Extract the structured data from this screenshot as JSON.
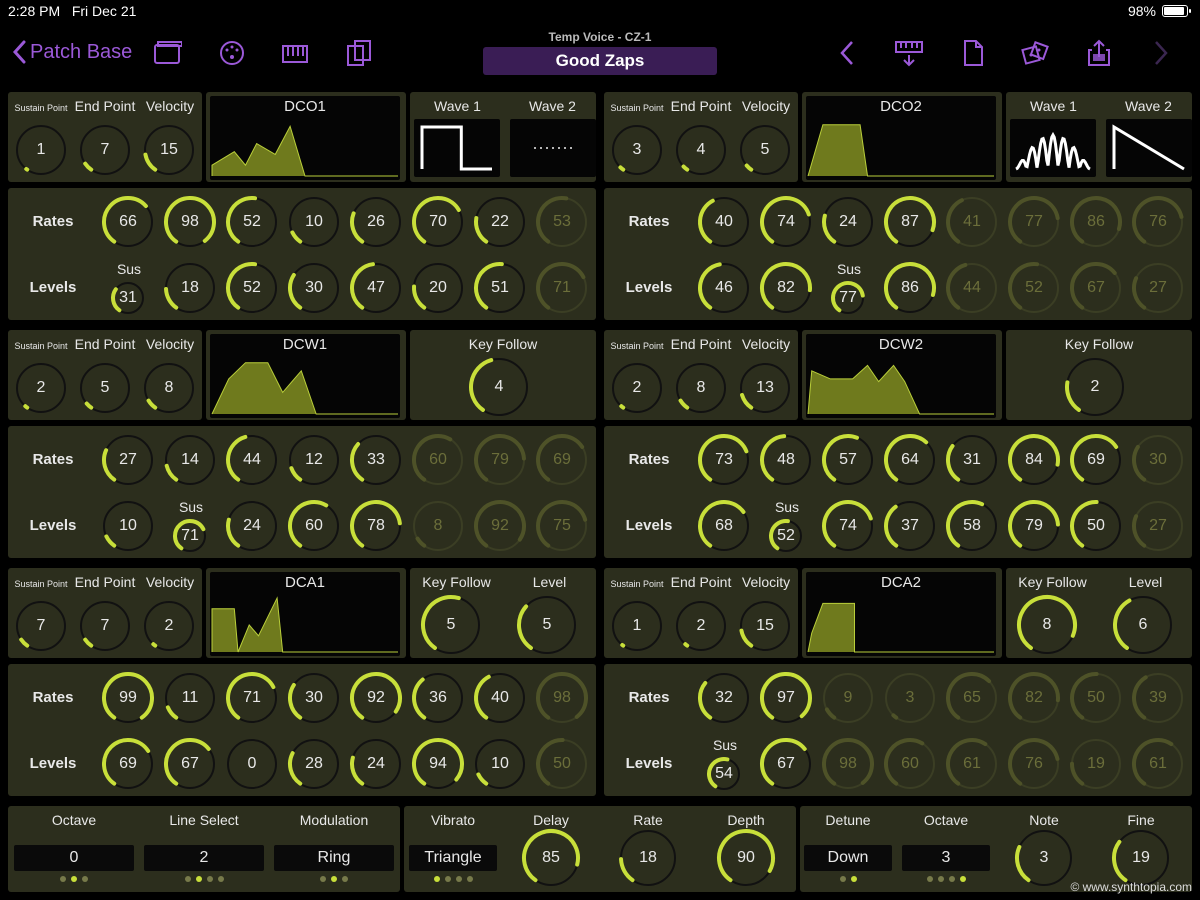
{
  "status": {
    "time": "2:28 PM",
    "date": "Fri Dec 21",
    "battery": "98%"
  },
  "nav": {
    "back_label": "Patch Base",
    "subtitle": "Temp Voice - CZ-1",
    "patch_name": "Good Zaps",
    "icons": [
      "windows-icon",
      "palette-icon",
      "keyboard-icon",
      "copy-icon",
      "prev-arrow-icon",
      "midi-keyboard-icon",
      "document-icon",
      "dice-icon",
      "share-icon",
      "next-arrow-icon"
    ]
  },
  "labels": {
    "sustain_point": "Sustain Point",
    "end_point": "End Point",
    "velocity": "Velocity",
    "rates": "Rates",
    "levels": "Levels",
    "sus": "Sus",
    "wave1": "Wave 1",
    "wave2": "Wave 2",
    "key_follow": "Key Follow",
    "level": "Level"
  },
  "colors": {
    "accent": "#c8df3a",
    "panel": "#2c2e1d",
    "nav_accent": "#9b59d8",
    "title_bg": "#3a1d55"
  },
  "sections": [
    {
      "env": "DCO1",
      "header_knobs": [
        1,
        7,
        15
      ],
      "rates": [
        66,
        98,
        52,
        10,
        26,
        70,
        22,
        53
      ],
      "levels": [
        31,
        18,
        52,
        30,
        47,
        20,
        51,
        71
      ],
      "active": 7,
      "sus_index": 0,
      "right": {
        "type": "waves",
        "wave1": "square",
        "wave2": "dots"
      }
    },
    {
      "env": "DCO2",
      "header_knobs": [
        3,
        4,
        5
      ],
      "rates": [
        40,
        74,
        24,
        87,
        41,
        77,
        86,
        76
      ],
      "levels": [
        46,
        82,
        77,
        86,
        44,
        52,
        67,
        27
      ],
      "active": 4,
      "sus_index": 2,
      "right": {
        "type": "waves",
        "wave1": "resonance",
        "wave2": "saw"
      }
    },
    {
      "env": "DCW1",
      "header_knobs": [
        2,
        5,
        8
      ],
      "rates": [
        27,
        14,
        44,
        12,
        33,
        60,
        79,
        69
      ],
      "levels": [
        10,
        71,
        24,
        60,
        78,
        8,
        92,
        75
      ],
      "active": 5,
      "sus_index": 1,
      "right": {
        "type": "keyfollow",
        "values": [
          4
        ]
      }
    },
    {
      "env": "DCW2",
      "header_knobs": [
        2,
        8,
        13
      ],
      "rates": [
        73,
        48,
        57,
        64,
        31,
        84,
        69,
        30
      ],
      "levels": [
        68,
        52,
        74,
        37,
        58,
        79,
        50,
        27
      ],
      "active": 7,
      "sus_index": 1,
      "right": {
        "type": "keyfollow",
        "values": [
          2
        ]
      }
    },
    {
      "env": "DCA1",
      "header_knobs": [
        7,
        7,
        2
      ],
      "rates": [
        99,
        11,
        71,
        30,
        92,
        36,
        40,
        98
      ],
      "levels": [
        69,
        67,
        0,
        28,
        24,
        94,
        10,
        50
      ],
      "active": 7,
      "sus_index": -1,
      "right": {
        "type": "keylevel",
        "values": [
          5,
          5
        ]
      }
    },
    {
      "env": "DCA2",
      "header_knobs": [
        1,
        2,
        15
      ],
      "rates": [
        32,
        97,
        9,
        3,
        65,
        82,
        50,
        39
      ],
      "levels": [
        54,
        67,
        98,
        60,
        61,
        76,
        19,
        61
      ],
      "active": 2,
      "sus_index": 0,
      "right": {
        "type": "keylevel",
        "values": [
          8,
          6
        ]
      }
    }
  ],
  "bottom": {
    "octave": {
      "label": "Octave",
      "value": "0",
      "dots": 3,
      "selected": 1
    },
    "line_select": {
      "label": "Line Select",
      "value": "2",
      "dots": 4,
      "selected": 1
    },
    "modulation": {
      "label": "Modulation",
      "value": "Ring",
      "dots": 3,
      "selected": 1
    },
    "vibrato": {
      "label": "Vibrato",
      "value": "Triangle",
      "dots": 4,
      "selected": 0
    },
    "delay": {
      "label": "Delay",
      "value": 85
    },
    "rate": {
      "label": "Rate",
      "value": 18
    },
    "depth": {
      "label": "Depth",
      "value": 90
    },
    "detune": {
      "label": "Detune",
      "value": "Down",
      "dots": 2,
      "selected": 1
    },
    "octave2": {
      "label": "Octave",
      "value": "3",
      "dots": 4,
      "selected": 3
    },
    "note": {
      "label": "Note",
      "value": 3
    },
    "fine": {
      "label": "Fine",
      "value": 19
    }
  },
  "credit": "© www.synthtopia.com"
}
